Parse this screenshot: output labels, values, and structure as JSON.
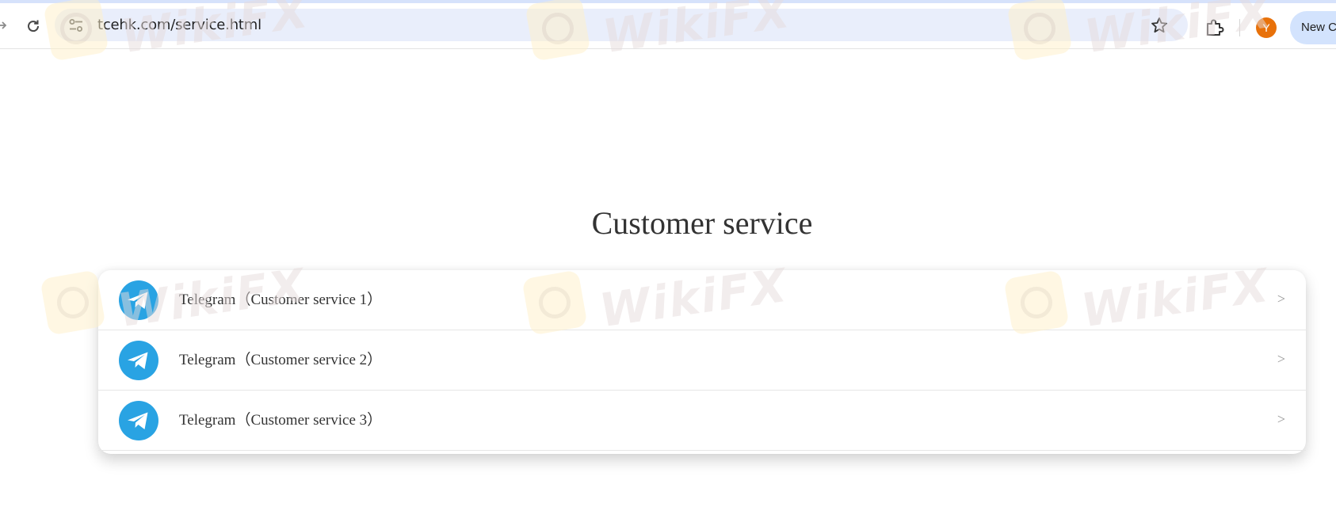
{
  "browser": {
    "url": "tcehk.com/service.html",
    "avatar_initial": "Y",
    "new_chrome_chip": "New C",
    "accent_color": "#d6e2fb",
    "avatar_color": "#e8710a"
  },
  "icons": {
    "back": "arrow-right-icon",
    "reload": "reload-icon",
    "site_info": "tune-icon",
    "bookmark": "star-icon",
    "extensions": "puzzle-icon",
    "service": "telegram-icon"
  },
  "main": {
    "title": "Customer service",
    "items": [
      {
        "label": "Telegram（Customer service 1）",
        "arrow": ">"
      },
      {
        "label": "Telegram（Customer service 2）",
        "arrow": ">"
      },
      {
        "label": "Telegram（Customer service 3）",
        "arrow": ">"
      }
    ],
    "telegram_color": "#29a3e3"
  },
  "watermark": {
    "text": "WikiFX"
  }
}
